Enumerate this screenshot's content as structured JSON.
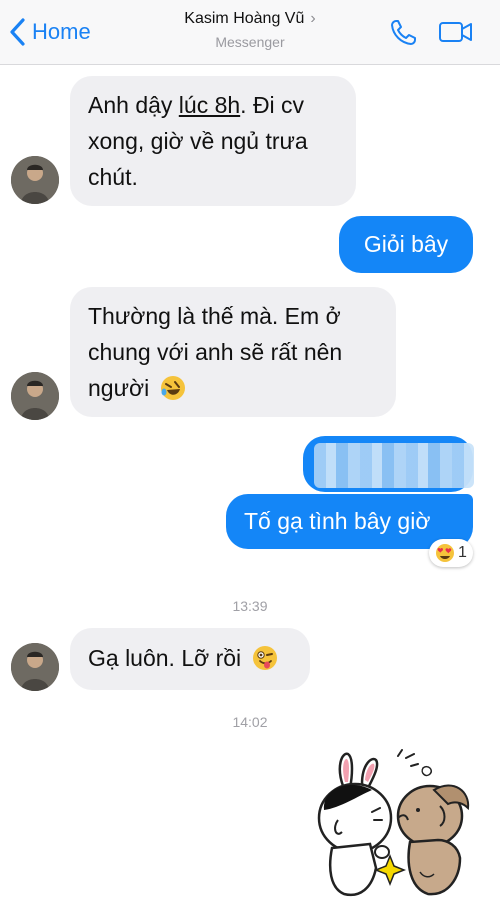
{
  "header": {
    "back_label": "Home",
    "contact_name": "Kasim Hoàng Vũ",
    "subtitle": "Messenger",
    "accent": "#1a82f4"
  },
  "messages": [
    {
      "from": "them",
      "text_before": "Anh dậy ",
      "underlined": "lúc 8h",
      "text_after": ". Đi cv xong, giờ về ngủ trưa chút."
    },
    {
      "from": "me",
      "text": "Giỏi bây"
    },
    {
      "from": "them",
      "text": "Thường là thế mà. Em ở chung với anh sẽ rất nên người",
      "emoji": "rofl-emoji"
    },
    {
      "from": "me",
      "text": "",
      "blurred": true
    },
    {
      "from": "me",
      "text": "Tố gạ tình bây giờ",
      "reaction_emoji": "heart-eyes-emoji",
      "reaction_count": "1"
    },
    {
      "timestamp": "13:39"
    },
    {
      "from": "them",
      "text": "Gạ luôn. Lỡ rồi",
      "emoji": "winking-tongue-emoji"
    },
    {
      "timestamp": "14:02"
    },
    {
      "from": "me",
      "sticker": "rabbit-and-dog-kiss-sticker"
    }
  ],
  "colors": {
    "outgoing_bubble": "#1486f7",
    "incoming_bubble": "#efeff2"
  }
}
